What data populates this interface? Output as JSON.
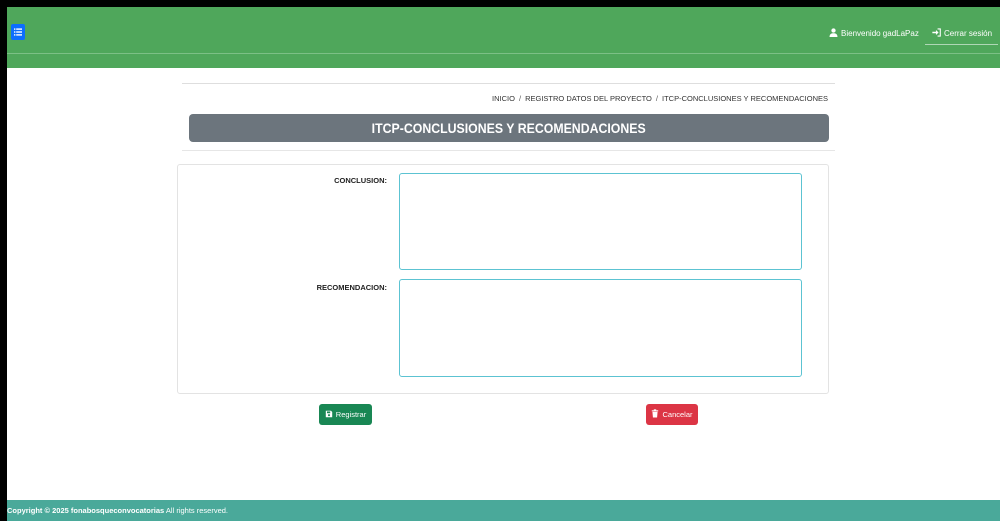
{
  "theme": {
    "header_green": "#4fa75b",
    "footer_teal": "#4aa99a",
    "title_bar_gray": "#6c757d",
    "menu_button_blue": "#0d6efd",
    "field_border": "#5cc3d2",
    "register_green": "#198754",
    "cancel_red": "#dc3545"
  },
  "header": {
    "menu_icon": "menu-list-icon",
    "user": {
      "icon": "user-icon",
      "label": "Bienvenido gadLaPaz"
    },
    "logout": {
      "icon": "sign-in-icon",
      "label": "Cerrar sesión"
    }
  },
  "breadcrumb": {
    "separator": "/",
    "items": [
      "INICIO",
      "REGISTRO DATOS DEL PROYECTO",
      "ITCP-CONCLUSIONES Y RECOMENDACIONES"
    ]
  },
  "page_title": "ITCP-CONCLUSIONES Y RECOMENDACIONES",
  "form": {
    "conclusion": {
      "label": "CONCLUSION:",
      "value": ""
    },
    "recomendacion": {
      "label": "RECOMENDACION:",
      "value": ""
    }
  },
  "actions": {
    "register": {
      "label": "Registrar",
      "icon": "save-icon"
    },
    "cancel": {
      "label": "Cancelar",
      "icon": "trash-icon"
    }
  },
  "footer": {
    "copyright": "Copyright © 2025 fonabosqueconvocatorias",
    "rights": "All rights reserved."
  }
}
